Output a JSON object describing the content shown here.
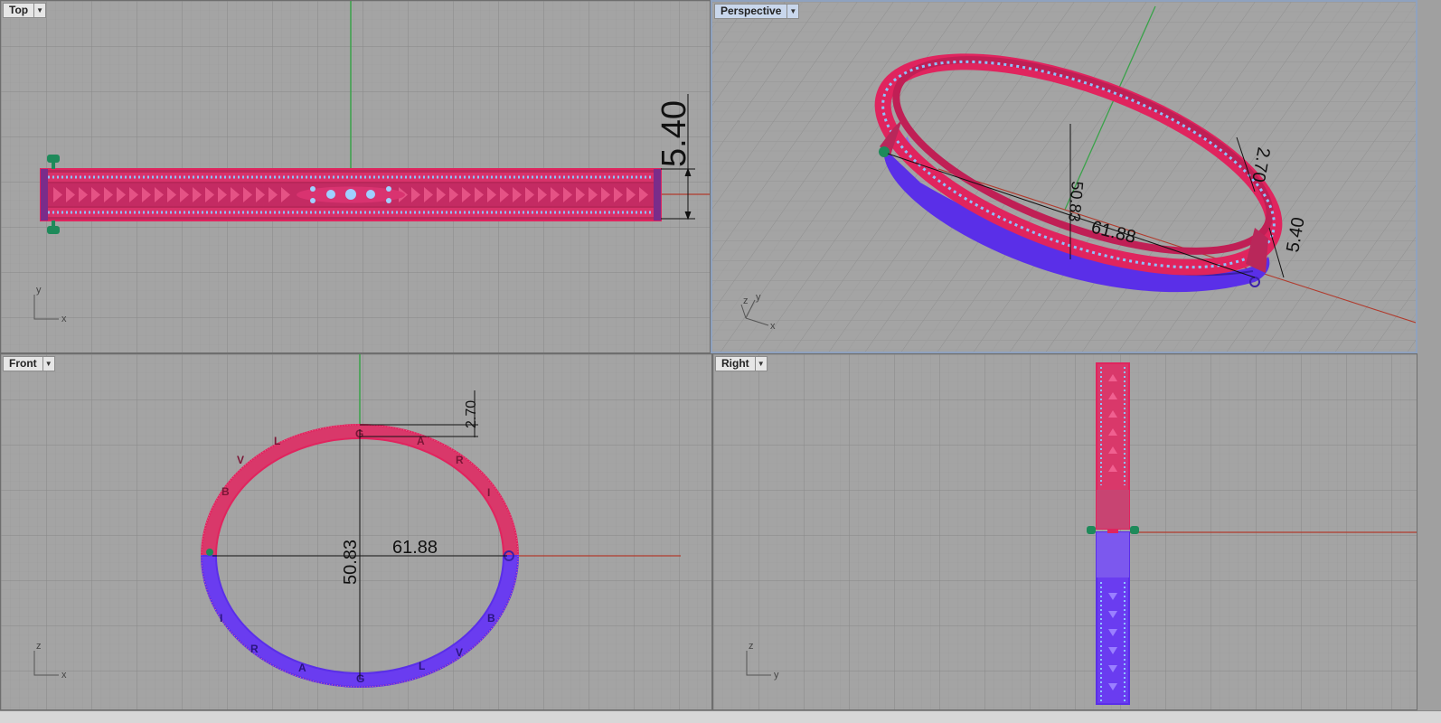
{
  "viewports": {
    "top": {
      "label": "Top",
      "menu_icon": "dropdown-arrow-icon",
      "axis_h": "x",
      "axis_v": "y",
      "dim_height": "5.40"
    },
    "perspective": {
      "label": "Perspective",
      "menu_icon": "dropdown-arrow-icon",
      "axis_h": "x",
      "axis_v": "y",
      "axis_z": "z",
      "dim_width": "61.88",
      "dim_height": "50.83",
      "dim_thickness": "2.70",
      "dim_depth": "5.40"
    },
    "front": {
      "label": "Front",
      "menu_icon": "dropdown-arrow-icon",
      "axis_h": "x",
      "axis_v": "z",
      "dim_width": "61.88",
      "dim_height": "50.83",
      "dim_thickness": "2.70"
    },
    "right": {
      "label": "Right",
      "menu_icon": "dropdown-arrow-icon",
      "axis_h": "y",
      "axis_v": "z"
    }
  },
  "colors": {
    "background": "#a4a4a4",
    "grid_minor": "#9a9a9a",
    "grid_major": "#8a8a8a",
    "axis_x": "#b13a2c",
    "axis_y": "#3aa24a",
    "selection_red": "#e0245e",
    "selection_blue": "#6a3cf0",
    "gem_light_blue": "#8ec3ff",
    "control_green": "#1e8a5a",
    "active_tab": "#c9d7ec"
  },
  "engraving_letters": [
    "B",
    "V",
    "L",
    "G",
    "A",
    "R",
    "I"
  ]
}
